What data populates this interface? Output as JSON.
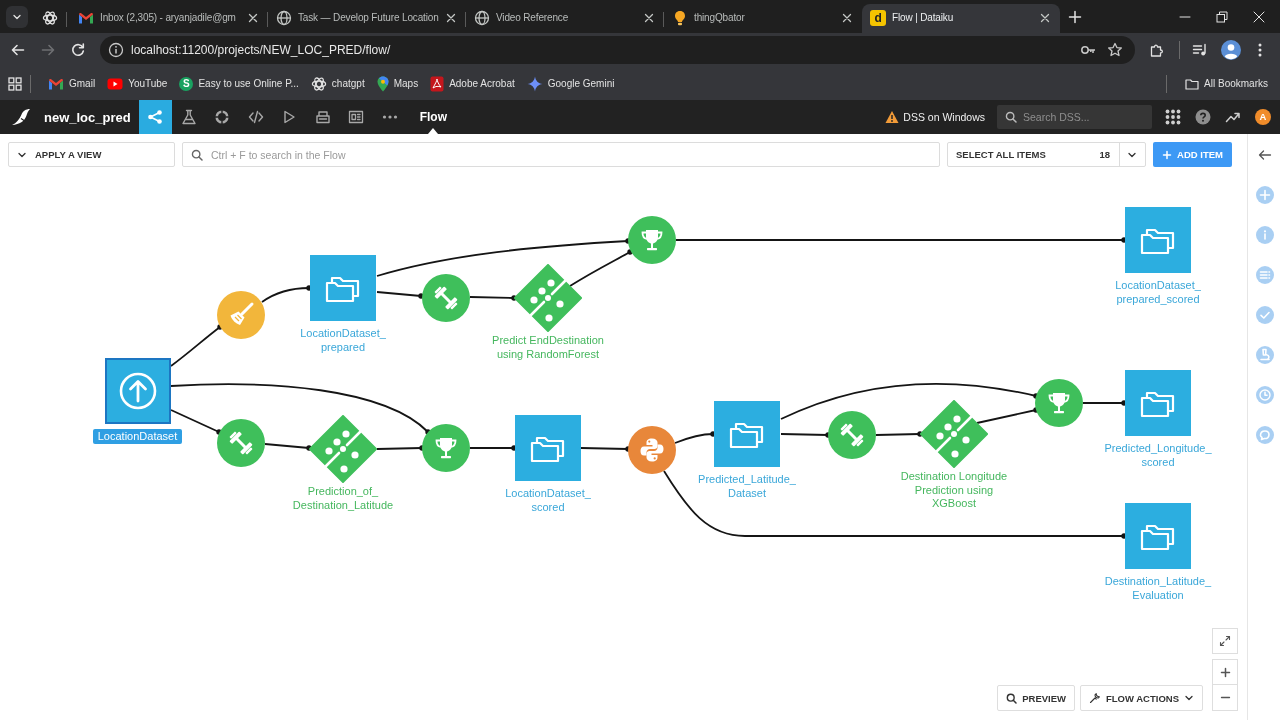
{
  "browser": {
    "tabs": [
      {
        "kind": "pinned",
        "selected": false,
        "closable": false
      },
      {
        "kind": "mail",
        "title": "Inbox (2,305) - aryanjadile@gm",
        "selected": false,
        "closable": true
      },
      {
        "kind": "web",
        "title": "Task — Develop Future Location",
        "selected": false,
        "closable": true
      },
      {
        "kind": "web",
        "title": "Video Reference",
        "selected": false,
        "closable": true
      },
      {
        "kind": "bulb",
        "title": "thingQbator",
        "selected": false,
        "closable": true
      },
      {
        "kind": "app",
        "badge": "d",
        "title": "Flow | Dataiku",
        "selected": true,
        "closable": true
      }
    ],
    "nav_buttons": [
      {
        "kind": "back",
        "disabled": false
      },
      {
        "kind": "forward",
        "disabled": true
      },
      {
        "kind": "reload",
        "disabled": false
      }
    ],
    "address_bar": {
      "url": "localhost:11200/projects/NEW_LOC_PRED/flow/"
    },
    "bookmarks": [
      {
        "kind": "mail",
        "label": "Gmail"
      },
      {
        "kind": "video",
        "label": "YouTube"
      },
      {
        "kind": "badge",
        "badge": "S",
        "label": "Easy to use Online P..."
      },
      {
        "kind": "knot",
        "label": "chatgpt"
      },
      {
        "kind": "pin",
        "label": "Maps"
      },
      {
        "kind": "pdf",
        "label": "Adobe Acrobat"
      },
      {
        "kind": "sparkle",
        "label": "Google Gemini"
      }
    ],
    "all_bookmarks": "All Bookmarks"
  },
  "app_header": {
    "project": "new_loc_pred",
    "nav": [
      {
        "kind": "flow",
        "selected": true
      },
      {
        "kind": "lab",
        "selected": false
      },
      {
        "kind": "ring",
        "selected": false
      },
      {
        "kind": "code",
        "selected": false
      },
      {
        "kind": "run",
        "selected": false
      },
      {
        "kind": "jobs",
        "selected": false
      },
      {
        "kind": "dashboard",
        "selected": false
      },
      {
        "kind": "more",
        "selected": false
      }
    ],
    "section": "Flow",
    "instance": "DSS on Windows",
    "search": {
      "placeholder": "Search DSS..."
    },
    "avatar": "A"
  },
  "toolbar": {
    "view_menu": "APPLY A VIEW",
    "search": {
      "placeholder": "Ctrl + F to search in the Flow"
    },
    "select_all": {
      "label": "SELECT ALL ITEMS",
      "count": "18"
    },
    "add_button": "ADD ITEM"
  },
  "flow": {
    "nodes": [
      {
        "kind": "uploaded_dataset",
        "label": "LocationDataset",
        "selected": true
      },
      {
        "kind": "prepare",
        "selected": false
      },
      {
        "kind": "dataset",
        "label": "LocationDataset_\nprepared",
        "selected": false
      },
      {
        "kind": "train",
        "selected": false
      },
      {
        "kind": "model",
        "label": "Predict EndDestination\nusing RandomForest",
        "selected": false
      },
      {
        "kind": "score",
        "selected": false
      },
      {
        "kind": "dataset",
        "label": "LocationDataset_\nprepared_scored",
        "selected": false
      },
      {
        "kind": "train",
        "selected": false
      },
      {
        "kind": "model",
        "label": "Prediction_of_\nDestination_Latitude",
        "selected": false
      },
      {
        "kind": "score",
        "selected": false
      },
      {
        "kind": "dataset",
        "label": "LocationDataset_\nscored",
        "selected": false
      },
      {
        "kind": "python",
        "selected": false
      },
      {
        "kind": "dataset",
        "label": "Predicted_Latitude_\nDataset",
        "selected": false
      },
      {
        "kind": "train",
        "selected": false
      },
      {
        "kind": "model",
        "label": "Destination Longitude\nPrediction using\nXGBoost",
        "selected": false
      },
      {
        "kind": "score",
        "selected": false
      },
      {
        "kind": "dataset",
        "label": "Predicted_Longitude_\nscored",
        "selected": false
      },
      {
        "kind": "dataset",
        "label": "Destination_Latitude_\nEvaluation",
        "selected": false
      }
    ]
  },
  "flow_controls": {
    "preview": "PREVIEW",
    "actions": "FLOW ACTIONS"
  }
}
